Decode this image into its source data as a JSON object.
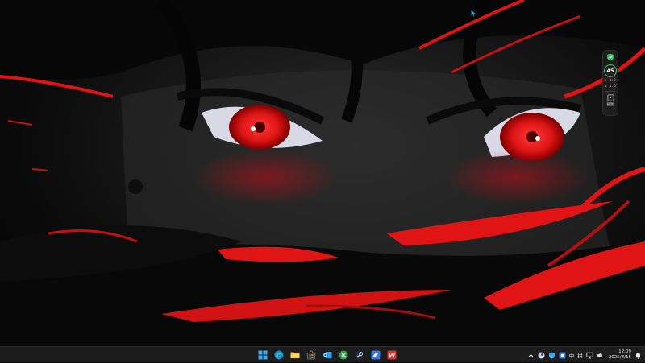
{
  "desktop": {
    "wallpaper_description_colors": {
      "accent": "#e01414",
      "shadow": "#0a0a0a",
      "skin": "#3a3a3a"
    }
  },
  "widget": {
    "score": "45",
    "upload_speed": "↑ 0.2",
    "download_speed": "↓ 1.6",
    "tool_label": "截图",
    "shield_color": "#3fbf6a"
  },
  "taskbar": {
    "apps": [
      {
        "name": "start-button",
        "icon": "windows-logo-icon"
      },
      {
        "name": "edge",
        "icon": "edge-browser-icon"
      },
      {
        "name": "file-explorer",
        "icon": "folder-icon"
      },
      {
        "name": "microsoft-store",
        "icon": "store-bag-icon"
      },
      {
        "name": "outlook",
        "icon": "outlook-icon"
      },
      {
        "name": "xbox",
        "icon": "xbox-icon"
      },
      {
        "name": "steam",
        "icon": "steam-icon"
      },
      {
        "name": "app-bird",
        "icon": "bird-app-icon"
      },
      {
        "name": "wps-office",
        "icon": "wps-icon"
      }
    ],
    "tray": {
      "ime_lang": "中",
      "ime_mode": "拼",
      "time": "12:09",
      "date": "2025/8/15"
    }
  }
}
